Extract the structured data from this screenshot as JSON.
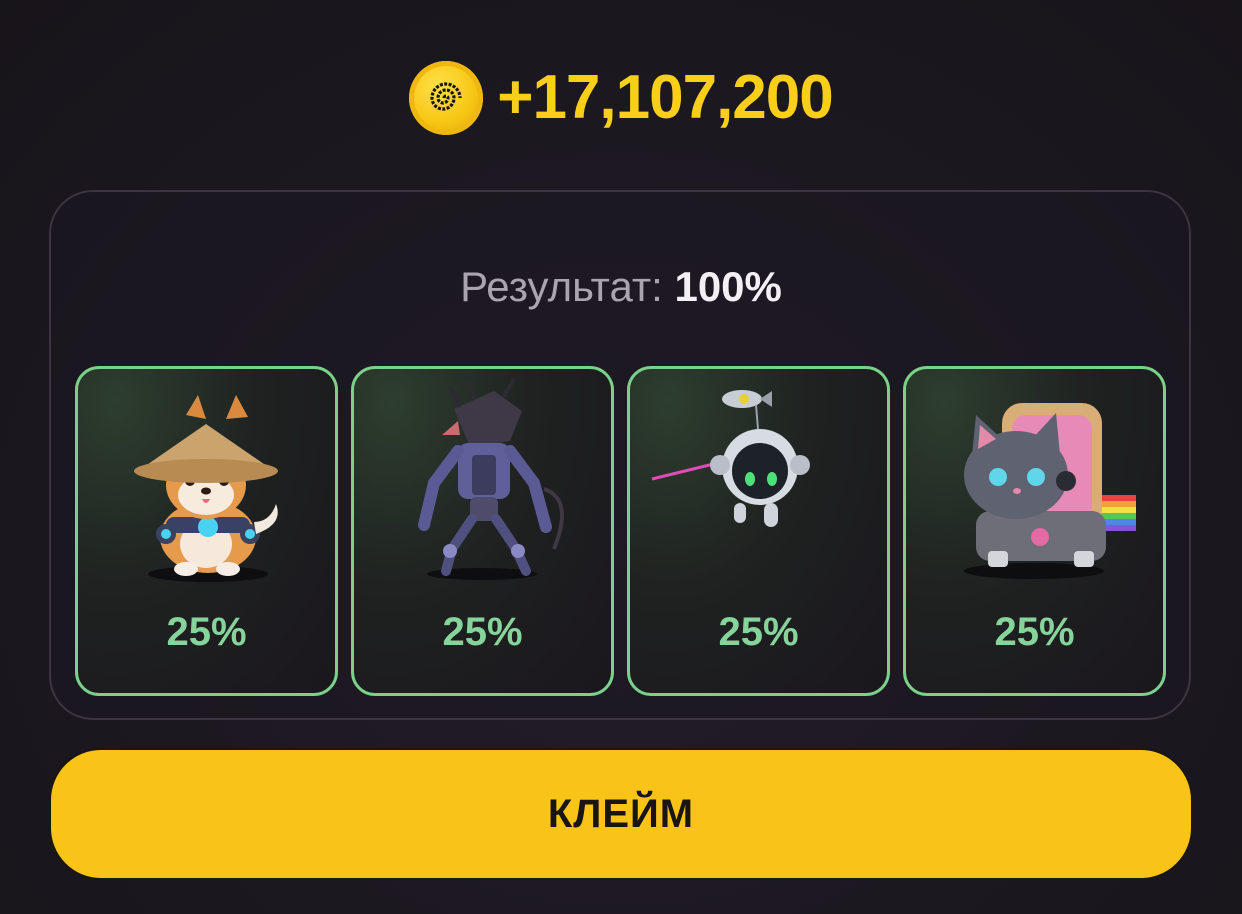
{
  "reward": {
    "amount": "+17,107,200",
    "coin_icon": "spiral-coin-icon",
    "accent_color": "#f9cf19"
  },
  "result": {
    "label": "Результат:",
    "value": "100%"
  },
  "cards": [
    {
      "name": "shiba-dog-hat",
      "percent": "25%"
    },
    {
      "name": "rat-robot",
      "percent": "25%"
    },
    {
      "name": "space-robot-bomb",
      "percent": "25%"
    },
    {
      "name": "nyan-cat-robot",
      "percent": "25%"
    }
  ],
  "card_border_color": "#7bd08a",
  "claim_button": {
    "label": "КЛЕЙМ",
    "color": "#f9c417"
  }
}
